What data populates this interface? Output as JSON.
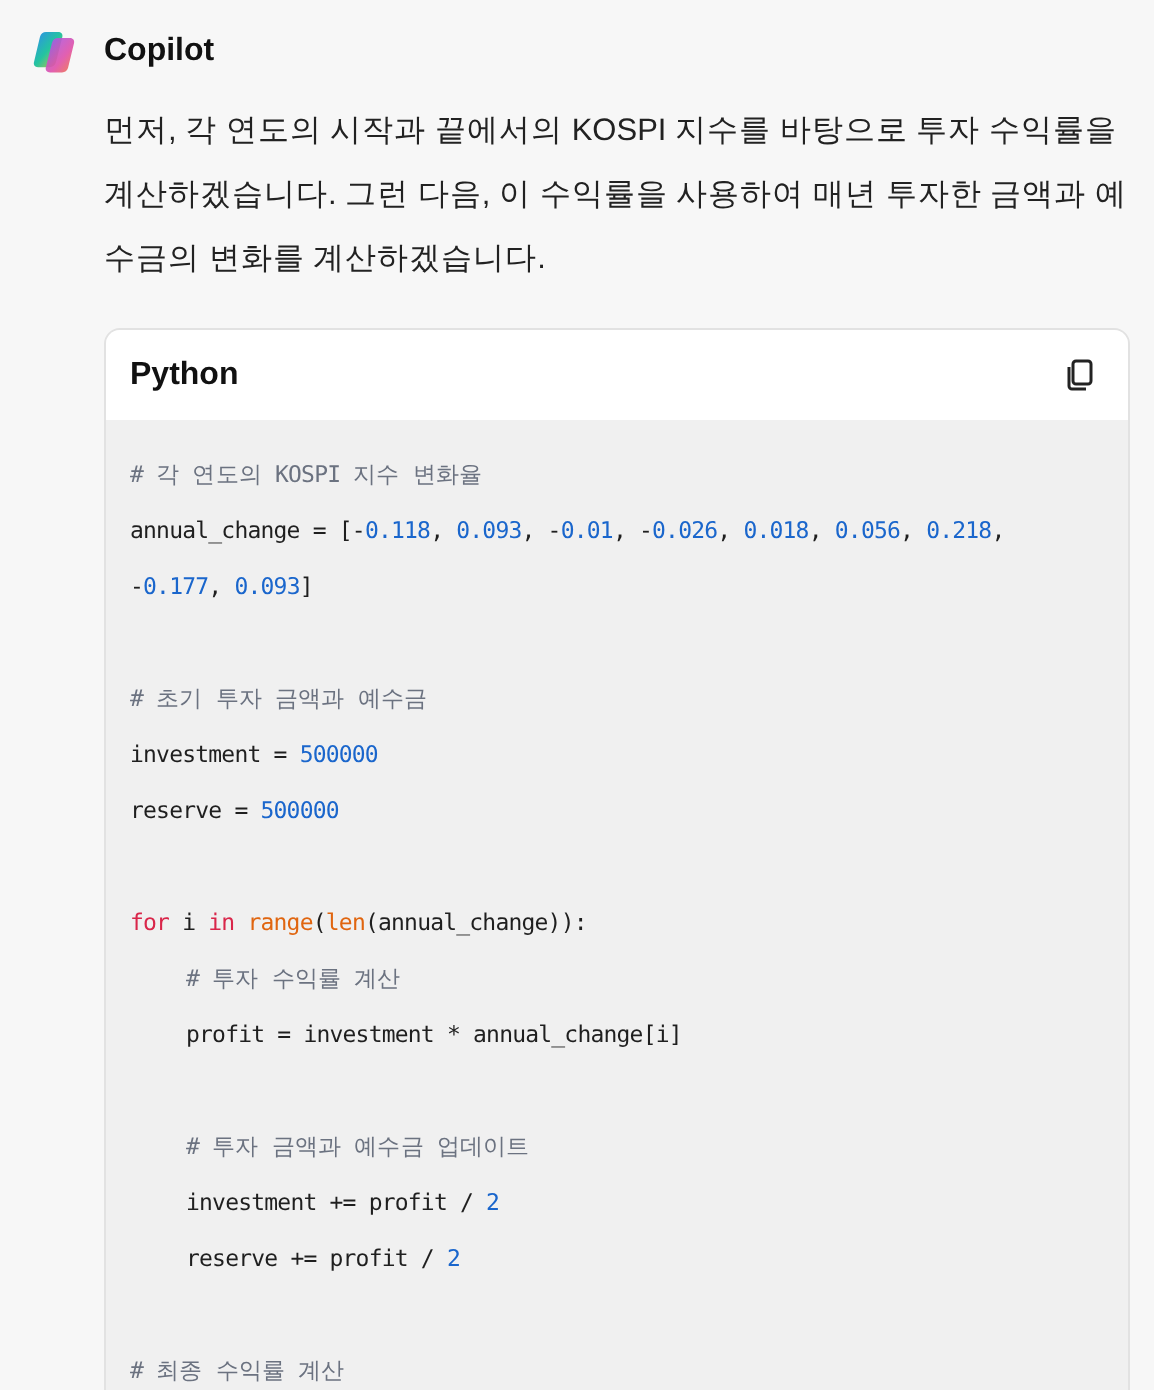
{
  "assistant": {
    "name": "Copilot"
  },
  "message": "먼저, 각 연도의 시작과 끝에서의 KOSPI 지수를 바탕으로 투자 수익률을 계산하겠습니다. 그런 다음, 이 수익률을 사용하여 매년 투자한 금액과 예수금의 변화를 계산하겠습니다.",
  "code_block": {
    "language": "Python",
    "lines": [
      {
        "kind": "code",
        "indented": false,
        "tokens": [
          {
            "text": "# 각 연도의 KOSPI 지수 변화율",
            "kind": "comment"
          }
        ]
      },
      {
        "kind": "code",
        "indented": false,
        "tokens": [
          {
            "text": "annual_change = [-",
            "kind": "plain"
          },
          {
            "text": "0.118",
            "kind": "number"
          },
          {
            "text": ", ",
            "kind": "plain"
          },
          {
            "text": "0.093",
            "kind": "number"
          },
          {
            "text": ", -",
            "kind": "plain"
          },
          {
            "text": "0.01",
            "kind": "number"
          },
          {
            "text": ", -",
            "kind": "plain"
          },
          {
            "text": "0.026",
            "kind": "number"
          },
          {
            "text": ", ",
            "kind": "plain"
          },
          {
            "text": "0.018",
            "kind": "number"
          },
          {
            "text": ", ",
            "kind": "plain"
          },
          {
            "text": "0.056",
            "kind": "number"
          },
          {
            "text": ", ",
            "kind": "plain"
          },
          {
            "text": "0.218",
            "kind": "number"
          },
          {
            "text": ", -",
            "kind": "plain"
          },
          {
            "text": "0.177",
            "kind": "number"
          },
          {
            "text": ", ",
            "kind": "plain"
          },
          {
            "text": "0.093",
            "kind": "number"
          },
          {
            "text": "]",
            "kind": "plain"
          }
        ]
      },
      {
        "kind": "blank"
      },
      {
        "kind": "code",
        "indented": false,
        "tokens": [
          {
            "text": "# 초기 투자 금액과 예수금",
            "kind": "comment"
          }
        ]
      },
      {
        "kind": "code",
        "indented": false,
        "tokens": [
          {
            "text": "investment = ",
            "kind": "plain"
          },
          {
            "text": "500000",
            "kind": "number"
          }
        ]
      },
      {
        "kind": "code",
        "indented": false,
        "tokens": [
          {
            "text": "reserve = ",
            "kind": "plain"
          },
          {
            "text": "500000",
            "kind": "number"
          }
        ]
      },
      {
        "kind": "blank"
      },
      {
        "kind": "code",
        "indented": false,
        "tokens": [
          {
            "text": "for",
            "kind": "keyword"
          },
          {
            "text": " i ",
            "kind": "plain"
          },
          {
            "text": "in ",
            "kind": "keyword"
          },
          {
            "text": "range",
            "kind": "builtin"
          },
          {
            "text": "(",
            "kind": "plain"
          },
          {
            "text": "len",
            "kind": "builtin"
          },
          {
            "text": "(annual_change)):",
            "kind": "plain"
          }
        ]
      },
      {
        "kind": "code",
        "indented": true,
        "tokens": [
          {
            "text": "# 투자 수익률 계산",
            "kind": "comment"
          }
        ]
      },
      {
        "kind": "code",
        "indented": true,
        "tokens": [
          {
            "text": "profit = investment * annual_change[i]",
            "kind": "plain"
          }
        ]
      },
      {
        "kind": "blank"
      },
      {
        "kind": "code",
        "indented": true,
        "tokens": [
          {
            "text": "# 투자 금액과 예수금 업데이트",
            "kind": "comment"
          }
        ]
      },
      {
        "kind": "code",
        "indented": true,
        "tokens": [
          {
            "text": "investment += profit / ",
            "kind": "plain"
          },
          {
            "text": "2",
            "kind": "number"
          }
        ]
      },
      {
        "kind": "code",
        "indented": true,
        "tokens": [
          {
            "text": "reserve += profit / ",
            "kind": "plain"
          },
          {
            "text": "2",
            "kind": "number"
          }
        ]
      },
      {
        "kind": "blank"
      },
      {
        "kind": "code",
        "indented": false,
        "tokens": [
          {
            "text": "# 최종 수익률 계산",
            "kind": "comment"
          }
        ]
      }
    ]
  }
}
